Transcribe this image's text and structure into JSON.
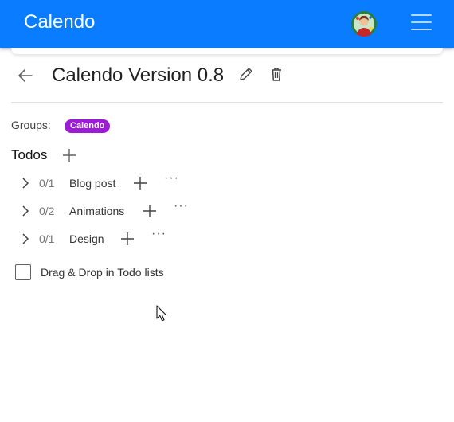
{
  "appbar": {
    "title": "Calendo",
    "avatar_icon": "user-avatar",
    "menu_icon": "hamburger-menu-icon",
    "color": "#0a7cff"
  },
  "page": {
    "title": "Calendo Version 0.8",
    "back_icon": "arrow-left-icon",
    "edit_icon": "pencil-icon",
    "delete_icon": "trash-icon"
  },
  "groups": {
    "label": "Groups:",
    "items": [
      {
        "label": "Calendo",
        "color": "#9c1bd6"
      }
    ]
  },
  "todos": {
    "heading": "Todos",
    "add_icon": "plus-icon",
    "lists": [
      {
        "count": "0/1",
        "name": "Blog post"
      },
      {
        "count": "0/2",
        "name": "Animations"
      },
      {
        "count": "0/1",
        "name": "Design"
      }
    ]
  },
  "drag_drop": {
    "label": "Drag & Drop in Todo lists",
    "checked": false
  },
  "row_more_label": "···"
}
